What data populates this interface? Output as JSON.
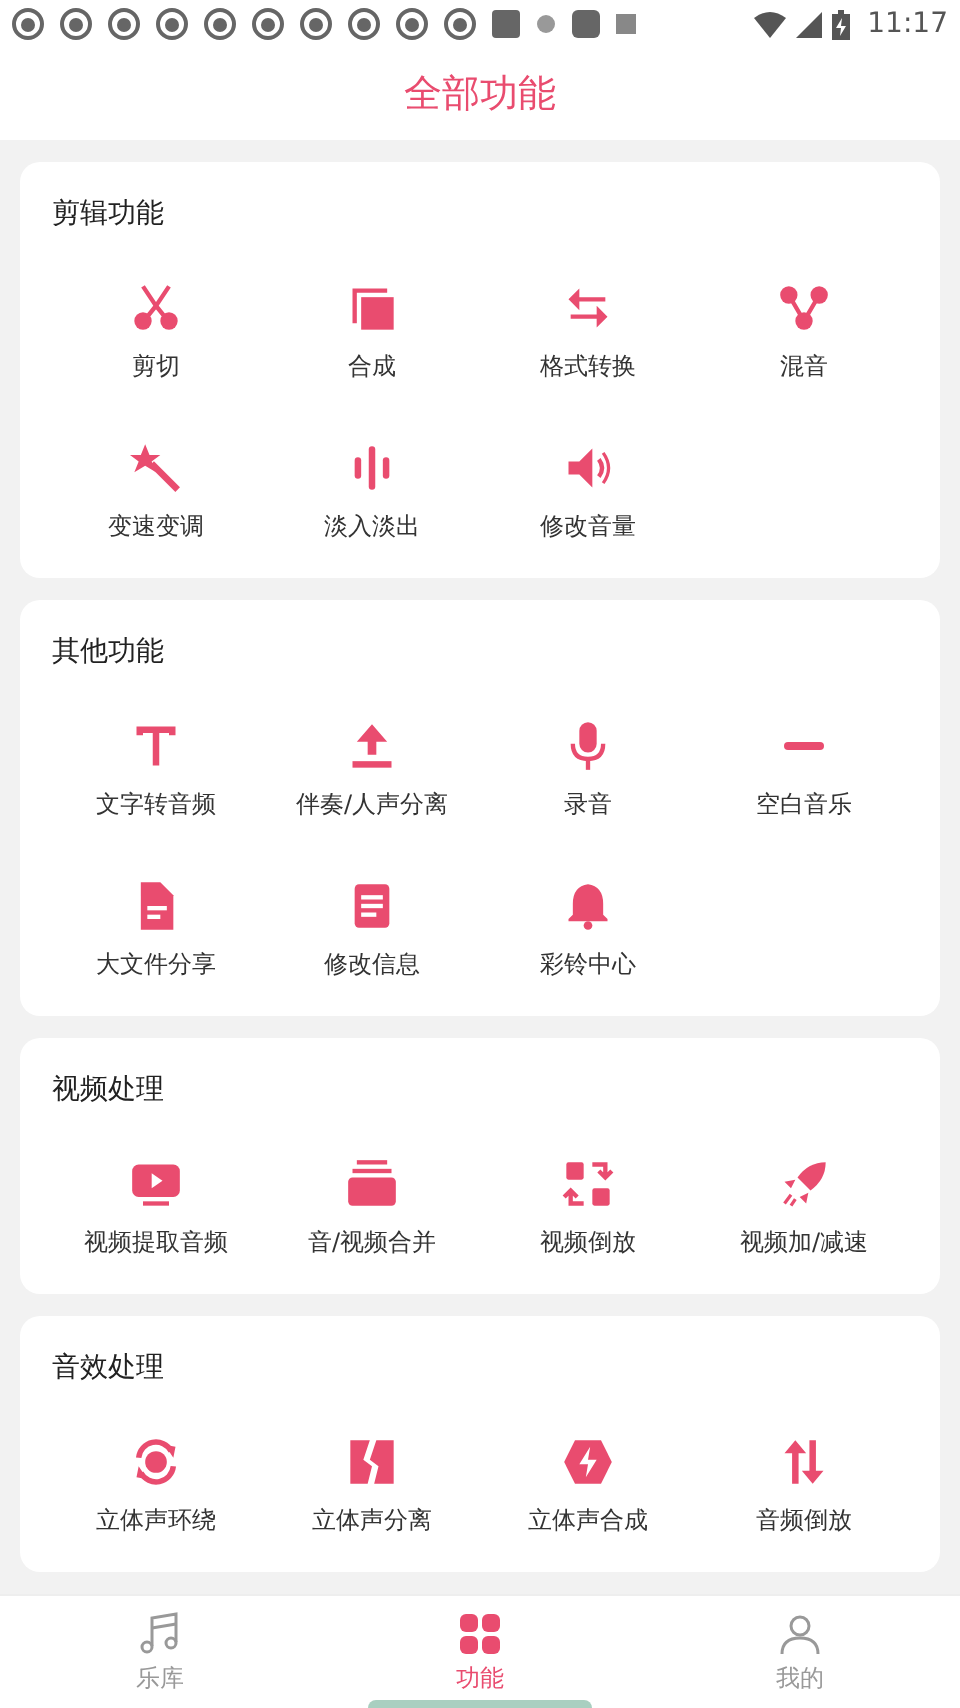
{
  "status_bar": {
    "time": "11:17"
  },
  "header": {
    "title": "全部功能"
  },
  "sections": [
    {
      "title": "剪辑功能",
      "items": [
        "剪切",
        "合成",
        "格式转换",
        "混音",
        "变速变调",
        "淡入淡出",
        "修改音量"
      ]
    },
    {
      "title": "其他功能",
      "items": [
        "文字转音频",
        "伴奏/人声分离",
        "录音",
        "空白音乐",
        "大文件分享",
        "修改信息",
        "彩铃中心"
      ]
    },
    {
      "title": "视频处理",
      "items": [
        "视频提取音频",
        "音/视频合并",
        "视频倒放",
        "视频加/减速"
      ]
    },
    {
      "title": "音效处理",
      "items": [
        "立体声环绕",
        "立体声分离",
        "立体声合成",
        "音频倒放"
      ]
    }
  ],
  "bottom_nav": [
    {
      "label": "乐库",
      "selected": false
    },
    {
      "label": "功能",
      "selected": true
    },
    {
      "label": "我的",
      "selected": false
    }
  ]
}
